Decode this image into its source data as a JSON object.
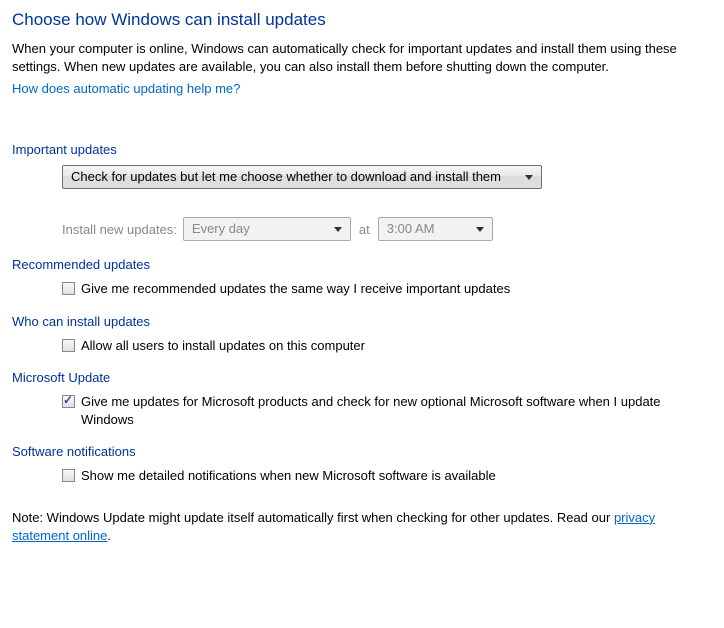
{
  "title": "Choose how Windows can install updates",
  "intro": "When your computer is online, Windows can automatically check for important updates and install them using these settings. When new updates are available, you can also install them before shutting down the computer.",
  "help_link": "How does automatic updating help me?",
  "sections": {
    "important": {
      "header": "Important updates",
      "policy_selected": "Check for updates but let me choose whether to download and install them",
      "schedule_label": "Install new updates:",
      "schedule_day_selected": "Every day",
      "schedule_at": "at",
      "schedule_time_selected": "3:00 AM"
    },
    "recommended": {
      "header": "Recommended updates",
      "checkbox_label": "Give me recommended updates the same way I receive important updates"
    },
    "who": {
      "header": "Who can install updates",
      "checkbox_label": "Allow all users to install updates on this computer"
    },
    "microsoft": {
      "header": "Microsoft Update",
      "checkbox_label": "Give me updates for Microsoft products and check for new optional Microsoft software when I update Windows"
    },
    "notifications": {
      "header": "Software notifications",
      "checkbox_label": "Show me detailed notifications when new Microsoft software is available"
    }
  },
  "note_prefix": "Note: Windows Update might update itself automatically first when checking for other updates.  Read our ",
  "note_link": "privacy statement online",
  "note_suffix": "."
}
